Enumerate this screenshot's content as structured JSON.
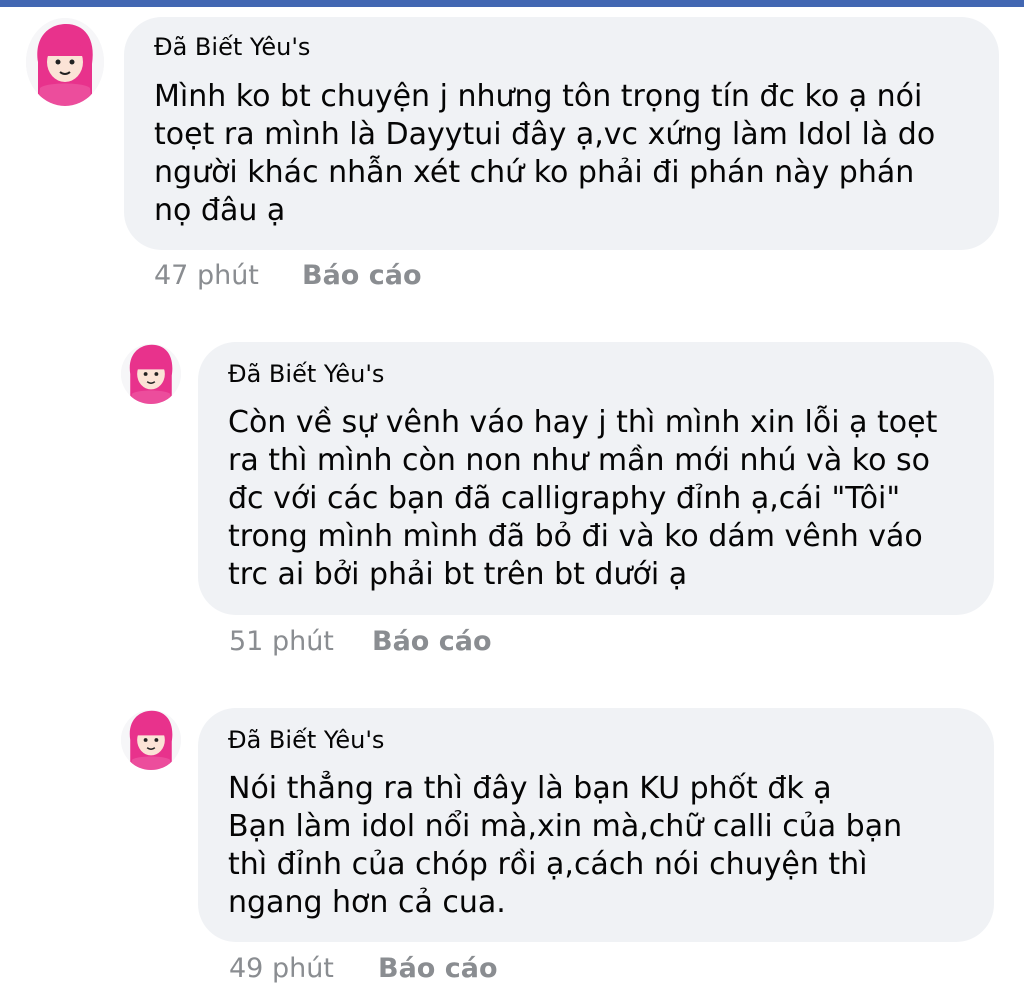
{
  "comments": [
    {
      "author": "Đã Biết Yêu's",
      "lines": [
        "Mình ko bt chuyện j nhưng tôn trọng tín đc ko ạ nói",
        "toẹt ra mình là Dayytui đây ạ,vc xứng làm Idol là do",
        "người khác nhẫn xét chứ ko phải đi phán này phán",
        "nọ đâu ạ"
      ],
      "time": "47 phút",
      "report_label": "Báo cáo"
    },
    {
      "author": "Đã Biết Yêu's",
      "lines": [
        "Còn về sự vênh váo hay j thì mình xin lỗi ạ toẹt",
        "ra thì mình còn non như mần mới nhú và ko so",
        "đc với các bạn đã calligraphy đỉnh ạ,cái \"Tôi\"",
        "trong mình mình đã bỏ đi và ko dám vênh váo",
        "trc ai bởi phải bt trên bt dưới ạ"
      ],
      "time": "51 phút",
      "report_label": "Báo cáo"
    },
    {
      "author": "Đã Biết Yêu's",
      "lines": [
        "Nói thẳng ra thì đây là bạn KU phốt đk ạ",
        "Bạn làm idol nổi mà,xin mà,chữ calli của bạn",
        "thì đỉnh của chóp rồi ạ,cách nói chuyện thì",
        "ngang hơn cả cua."
      ],
      "time": "49 phút",
      "report_label": "Báo cáo"
    }
  ],
  "colors": {
    "bubble": "#f0f2f5",
    "meta": "#8a8d91",
    "text": "#050505",
    "avatar_hair": "#e8328c"
  },
  "icons": {
    "avatar": "pink-haired-cartoon-avatar-icon"
  }
}
